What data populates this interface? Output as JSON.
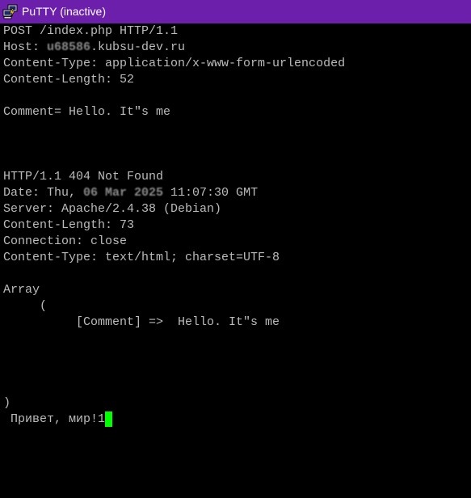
{
  "window": {
    "title": "PuTTY (inactive)",
    "icon": "putty-app-icon",
    "titlebar_color": "#6b1faa"
  },
  "terminal": {
    "fg_color": "#bbbbbb",
    "bg_color": "#000000",
    "cursor_color": "#00ff00",
    "request": {
      "request_line": "POST /index.php HTTP/1.1",
      "host_prefix": "Host: ",
      "host_redacted": "u68586",
      "host_suffix": ".kubsu-dev.ru",
      "content_type": "Content-Type: application/x-www-form-urlencoded",
      "content_length": "Content-Length: 52",
      "body": "Comment= Hello. It\"s me"
    },
    "response": {
      "status_line": "HTTP/1.1 404 Not Found",
      "date_prefix": "Date: Thu,",
      "date_redacted": " 06 Mar 2025",
      "date_suffix": " 11:07:30 GMT",
      "server": "Server: Apache/2.4.38 (Debian)",
      "content_length": "Content-Length: 73",
      "connection": "Connection: close",
      "content_type": "Content-Type: text/html; charset=UTF-8",
      "array_label": "Array",
      "array_open": "     (",
      "array_entry": "          [Comment] =>  Hello. It\"s me",
      "array_close": ")",
      "extra_output": " Привет, мир!1"
    }
  }
}
